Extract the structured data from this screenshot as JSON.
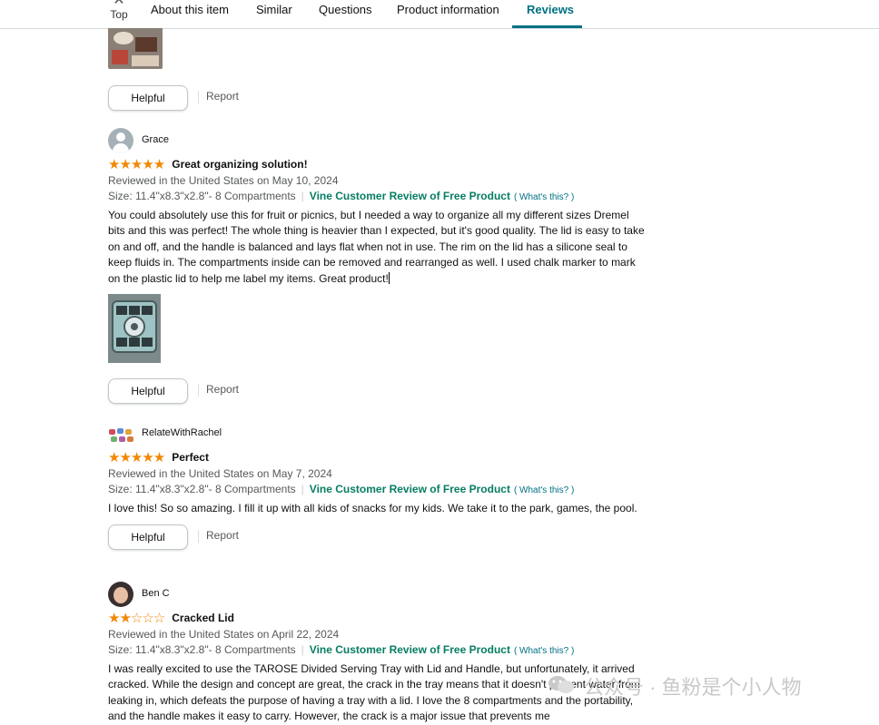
{
  "nav": {
    "top_label": "Top",
    "tabs": [
      "About this item",
      "Similar",
      "Questions",
      "Product information",
      "Reviews"
    ]
  },
  "actions": {
    "helpful": "Helpful",
    "report": "Report"
  },
  "reviews": [
    {
      "reviewer": "Grace",
      "stars": 5,
      "stars_text": "★★★★★",
      "title": "Great organizing solution!",
      "date": "Reviewed in the United States on May 10, 2024",
      "size": "Size: 11.4\"x8.3\"x2.8\"- 8 Compartments",
      "vine": "Vine Customer Review of Free Product",
      "whats_this": "( What's this? )",
      "body": "You could absolutely use this for fruit or picnics, but I needed a way to organize all my different sizes Dremel bits and this was perfect! The whole thing is heavier than I expected, but it's good quality. The lid is easy to take on and off, and the handle is balanced and lays flat when not in use. The rim on the lid has a silicone seal to keep fluids in. The compartments inside can be removed and rearranged as well. I used chalk marker to mark on the plastic lid to help me label my items. Great product!"
    },
    {
      "reviewer": "RelateWithRachel",
      "stars": 5,
      "stars_text": "★★★★★",
      "title": "Perfect",
      "date": "Reviewed in the United States on May 7, 2024",
      "size": "Size: 11.4\"x8.3\"x2.8\"- 8 Compartments",
      "vine": "Vine Customer Review of Free Product",
      "whats_this": "( What's this? )",
      "body": "I love this! So so amazing. I fill it up with all kids of snacks for my kids. We take it to the park, games, the pool."
    },
    {
      "reviewer": "Ben C",
      "stars": 2,
      "stars_text": "★★☆☆☆",
      "title": "Cracked Lid",
      "date": "Reviewed in the United States on April 22, 2024",
      "size": "Size: 11.4\"x8.3\"x2.8\"- 8 Compartments",
      "vine": "Vine Customer Review of Free Product",
      "whats_this": "( What's this? )",
      "body": "I was really excited to use the TAROSE Divided Serving Tray with Lid and Handle, but unfortunately, it arrived cracked. While the design and concept are great, the crack in the tray means that it doesn't prevent water from leaking in, which defeats the purpose of having a tray with a lid. I love the 8 compartments and the portability, and the handle makes it easy to carry. However, the crack is a major issue that prevents me"
    }
  ],
  "watermark": "公众号 · 鱼粉是个小人物"
}
